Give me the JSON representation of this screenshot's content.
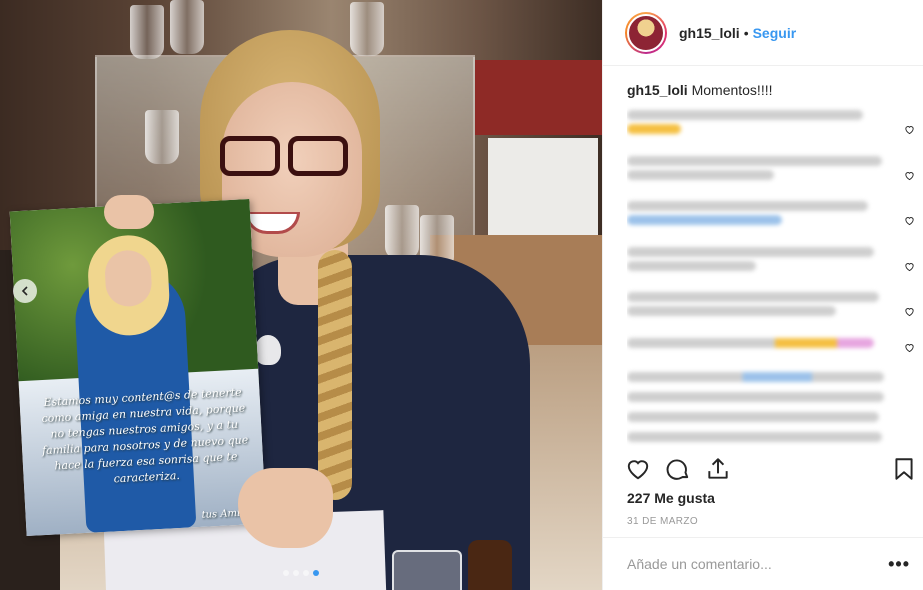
{
  "post": {
    "username": "gh15_loli",
    "separator": "•",
    "follow_label": "Seguir",
    "caption_user": "gh15_loli",
    "caption_text": "Momentos!!!!",
    "likes": "227 Me gusta",
    "date": "31 DE MARZO",
    "comment_placeholder": "Añade un comentario...",
    "more_label": "•••"
  },
  "photo": {
    "card_text": "Estamos muy content@s de tenerte como amiga en nuestra vida, porque no tengas nuestros amigos, y a tu familia para nosotros y de nuevo que hace la fuerza esa sonrisa que te caracteriza.",
    "card_signature": "tus Amigos",
    "carousel": {
      "slides": 4,
      "active": 3
    }
  },
  "comments_count_visible": 8,
  "icons": [
    "heart-icon",
    "comment-icon",
    "share-icon",
    "bookmark-icon",
    "chevron-left-icon"
  ],
  "colors": {
    "accent": "#3897f0",
    "text": "#262626",
    "muted": "#999999",
    "border": "#efefef"
  }
}
